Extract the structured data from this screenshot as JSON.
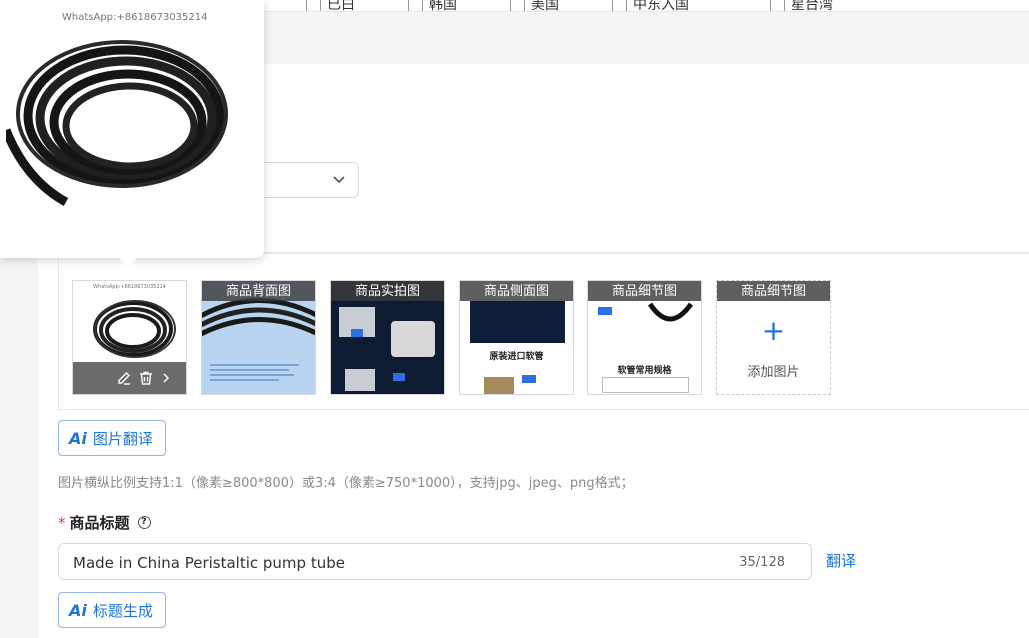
{
  "top_options": [
    {
      "label": "已白"
    },
    {
      "label": "韩国"
    },
    {
      "label": "美国"
    },
    {
      "label": "中东入国"
    },
    {
      "label": "星台湾"
    }
  ],
  "popover": {
    "watermark": "WhatsApp:+8618673035214"
  },
  "images": {
    "main_watermark": "WhatsApp:+8618673035214",
    "items": [
      {
        "caption": "商品背面图"
      },
      {
        "caption": "商品实拍图"
      },
      {
        "caption": "商品侧面图"
      },
      {
        "caption": "商品细节图"
      }
    ],
    "add_slot": {
      "caption": "商品细节图",
      "label": "添加图片"
    },
    "detail_inner_text": "软管常用规格",
    "side_inner_text": "原装进口软管"
  },
  "image_translate_button": {
    "icon_text": "Ai",
    "label": "图片翻译"
  },
  "hint": "图片横纵比例支持1:1（像素≥800*800）或3:4（像素≥750*1000），支持jpg、jpeg、png格式；",
  "title_field": {
    "required_mark": "*",
    "label": "商品标题",
    "help_icon": "?",
    "value": "Made in China Peristaltic pump tube",
    "counter": "35/128",
    "translate": "翻译"
  },
  "title_generate_button": {
    "icon_text": "Ai",
    "label": "标题生成"
  },
  "colors": {
    "accent": "#1f74d8",
    "required": "#e53935"
  }
}
